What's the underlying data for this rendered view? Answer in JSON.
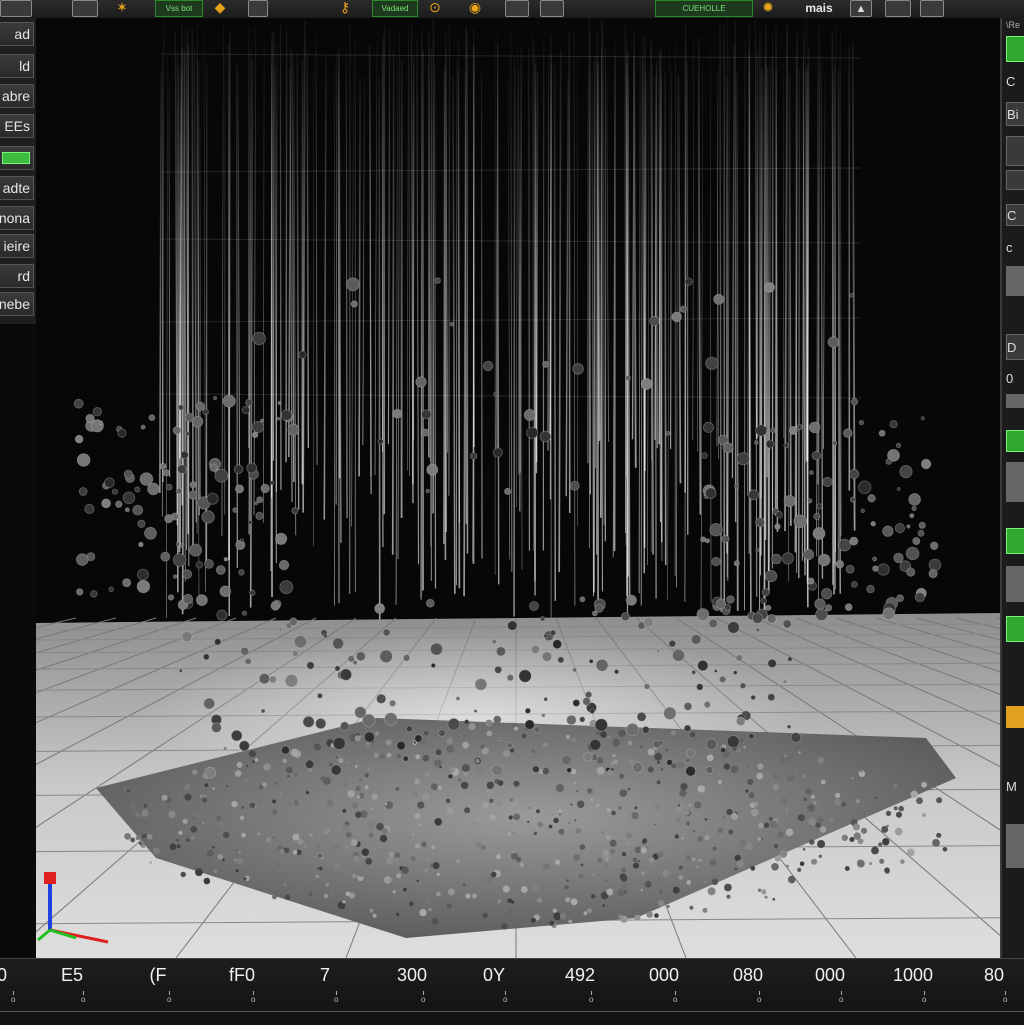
{
  "toolbar": {
    "items": [
      {
        "name": "toolbar-file-button",
        "kind": "box",
        "label": ""
      },
      {
        "name": "toolbar-open-button",
        "kind": "box",
        "label": ""
      },
      {
        "name": "toolbar-star-icon",
        "kind": "orange",
        "label": "✶"
      },
      {
        "name": "toolbar-green-badge",
        "kind": "green",
        "label": "Vss bot"
      },
      {
        "name": "toolbar-cube-icon",
        "kind": "orange",
        "label": "◆"
      },
      {
        "name": "toolbar-flag-icon",
        "kind": "box",
        "label": ""
      },
      {
        "name": "toolbar-key-icon",
        "kind": "orange",
        "label": "⚷"
      },
      {
        "name": "toolbar-green-badge-2",
        "kind": "green",
        "label": "Vadaed"
      },
      {
        "name": "toolbar-ring-icon",
        "kind": "orange",
        "label": "⊙"
      },
      {
        "name": "toolbar-ring-icon-2",
        "kind": "orange",
        "label": "◉"
      },
      {
        "name": "toolbar-doc-icon",
        "kind": "box",
        "label": ""
      },
      {
        "name": "toolbar-edit-icon",
        "kind": "box",
        "label": ""
      },
      {
        "name": "toolbar-green-badge-3",
        "kind": "green",
        "label": "CUEHOLLE"
      },
      {
        "name": "toolbar-emitter-icon",
        "kind": "orange",
        "label": "✹"
      },
      {
        "name": "toolbar-mats-label",
        "kind": "text",
        "label": "mais"
      },
      {
        "name": "toolbar-mountain-icon",
        "kind": "box",
        "label": "▲"
      },
      {
        "name": "toolbar-render-icon",
        "kind": "box",
        "label": ""
      },
      {
        "name": "toolbar-display-icon",
        "kind": "box",
        "label": ""
      }
    ]
  },
  "left_panel": {
    "buttons": [
      {
        "label": "ad",
        "style": "plain"
      },
      {
        "label": "ld",
        "style": "plain"
      },
      {
        "label": "abre",
        "style": "plain"
      },
      {
        "label": "EEs",
        "style": "plain"
      },
      {
        "label": "",
        "style": "green"
      },
      {
        "label": "adte",
        "style": "plain"
      },
      {
        "label": "nona",
        "style": "plain"
      },
      {
        "label": "ieire",
        "style": "plain"
      },
      {
        "label": "rd",
        "style": "plain"
      },
      {
        "label": "nebe",
        "style": "plain"
      }
    ]
  },
  "right_panel": {
    "header": "\\Re",
    "slots": [
      {
        "label": "",
        "style": "green"
      },
      {
        "label": "C",
        "style": "plain"
      },
      {
        "label": "Bi",
        "style": "box"
      },
      {
        "label": "",
        "style": "box"
      },
      {
        "label": "",
        "style": "box"
      },
      {
        "label": "C",
        "style": "box"
      },
      {
        "label": "c",
        "style": "plain"
      },
      {
        "label": "",
        "style": "gray"
      },
      {
        "label": "D",
        "style": "box"
      },
      {
        "label": "0",
        "style": "plain"
      },
      {
        "label": "",
        "style": "gray"
      },
      {
        "label": "",
        "style": "green"
      },
      {
        "label": "",
        "style": "gray"
      },
      {
        "label": "",
        "style": "green"
      },
      {
        "label": "",
        "style": "gray"
      },
      {
        "label": "",
        "style": "green"
      },
      {
        "label": "",
        "style": "orange"
      },
      {
        "label": "M",
        "style": "plain"
      },
      {
        "label": "",
        "style": "gray"
      }
    ]
  },
  "timeline": {
    "labels": [
      "0",
      "E5",
      "(F",
      "fF0",
      "7",
      "300",
      "0Y",
      "492",
      "000",
      "080",
      "000",
      "1000",
      "80"
    ],
    "tick_glyph": "o"
  },
  "scene": {
    "background_color": "#070707",
    "floor_color": "#cfcfcf",
    "particle_color": "#555555",
    "axis_colors": {
      "x": "#e02020",
      "y": "#20c020",
      "z": "#2040e0"
    }
  }
}
